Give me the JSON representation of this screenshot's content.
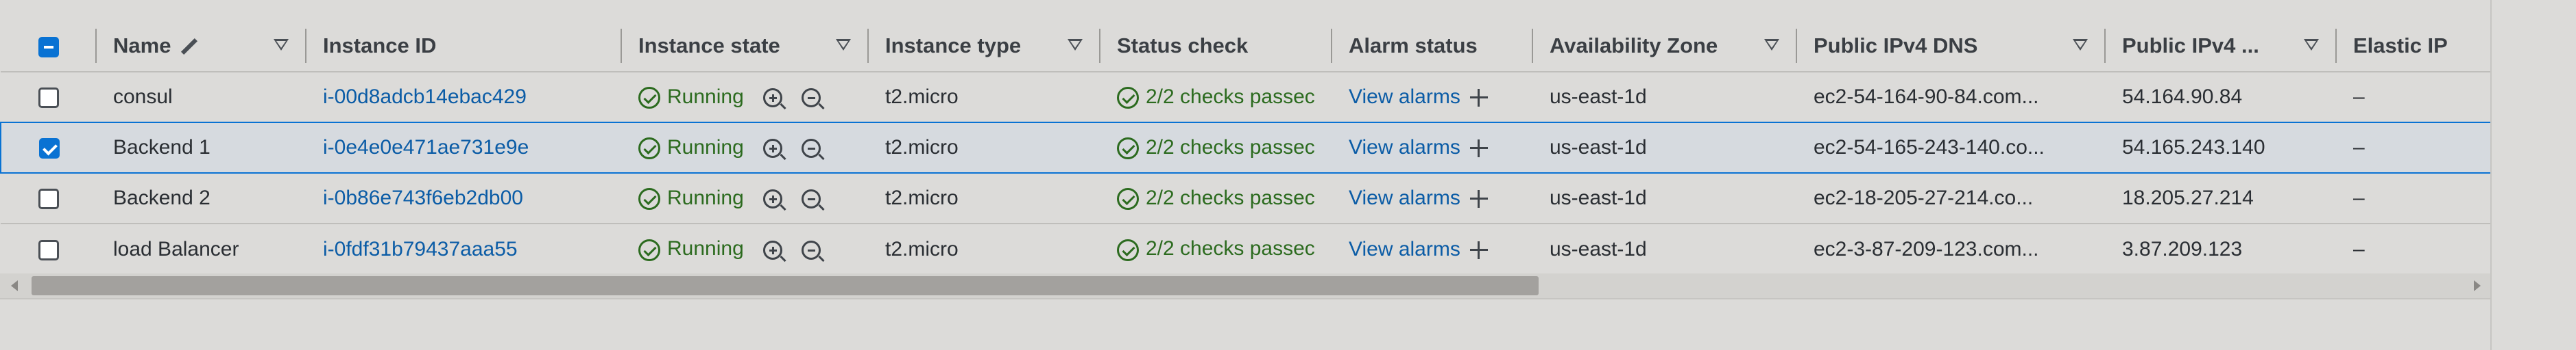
{
  "table": {
    "columns": [
      {
        "key": "name",
        "label": "Name",
        "sortable": true,
        "editable": true
      },
      {
        "key": "instance_id",
        "label": "Instance ID",
        "sortable": false
      },
      {
        "key": "state",
        "label": "Instance state",
        "sortable": true
      },
      {
        "key": "type",
        "label": "Instance type",
        "sortable": true
      },
      {
        "key": "status",
        "label": "Status check",
        "sortable": false
      },
      {
        "key": "alarm",
        "label": "Alarm status",
        "sortable": false
      },
      {
        "key": "az",
        "label": "Availability Zone",
        "sortable": true
      },
      {
        "key": "dns",
        "label": "Public IPv4 DNS",
        "sortable": true
      },
      {
        "key": "ip",
        "label": "Public IPv4 ...",
        "sortable": true
      },
      {
        "key": "eip",
        "label": "Elastic IP",
        "sortable": false
      }
    ],
    "rows": [
      {
        "selected": false,
        "name": "consul",
        "instance_id": "i-00d8adcb14ebac429",
        "state": "Running",
        "type": "t2.micro",
        "status": "2/2 checks passec",
        "alarm": "View alarms",
        "az": "us-east-1d",
        "dns": "ec2-54-164-90-84.com...",
        "ip": "54.164.90.84",
        "eip": "–"
      },
      {
        "selected": true,
        "name": "Backend 1",
        "instance_id": "i-0e4e0e471ae731e9e",
        "state": "Running",
        "type": "t2.micro",
        "status": "2/2 checks passec",
        "alarm": "View alarms",
        "az": "us-east-1d",
        "dns": "ec2-54-165-243-140.co...",
        "ip": "54.165.243.140",
        "eip": "–"
      },
      {
        "selected": false,
        "name": "Backend 2",
        "instance_id": "i-0b86e743f6eb2db00",
        "state": "Running",
        "type": "t2.micro",
        "status": "2/2 checks passec",
        "alarm": "View alarms",
        "az": "us-east-1d",
        "dns": "ec2-18-205-27-214.co...",
        "ip": "18.205.27.214",
        "eip": "–"
      },
      {
        "selected": false,
        "name": "load Balancer",
        "instance_id": "i-0fdf31b79437aaa55",
        "state": "Running",
        "type": "t2.micro",
        "status": "2/2 checks passec",
        "alarm": "View alarms",
        "az": "us-east-1d",
        "dns": "ec2-3-87-209-123.com...",
        "ip": "3.87.209.123",
        "eip": "–"
      }
    ]
  },
  "colors": {
    "accent": "#0972d3",
    "link": "#0b5ca6",
    "success": "#2c6b1f",
    "background": "#dcdbd9"
  },
  "icons": {
    "running": "check-circle-icon",
    "zoom_in": "zoom-in-icon",
    "zoom_out": "zoom-out-icon",
    "add_alarm": "plus-icon",
    "edit_name": "pencil-icon",
    "sort": "sort-caret-icon"
  }
}
